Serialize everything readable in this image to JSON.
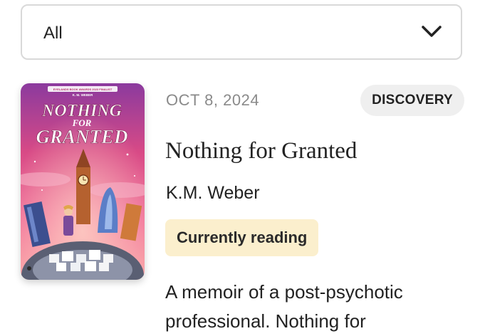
{
  "filter": {
    "value": "All",
    "icon": "chevron-down-icon"
  },
  "book": {
    "date": "OCT 8, 2024",
    "badge": "DISCOVERY",
    "title": "Nothing for Granted",
    "author": "K.M. Weber",
    "status": "Currently reading",
    "description": "A memoir of a post-psychotic professional. Nothing for",
    "cover": {
      "award_text": "EYELANDS BOOK AWARDS 2023 FINALIST",
      "author_text": "K. M. WEBER",
      "title_line1": "NOTHING",
      "title_line2": "FOR",
      "title_line3": "GRANTED"
    }
  },
  "colors": {
    "status_bg": "#fbefcd",
    "badge_bg": "#efefef",
    "date": "#8a8a8a",
    "cover_pink": "#e0457f",
    "cover_purple": "#6a3a8f"
  }
}
